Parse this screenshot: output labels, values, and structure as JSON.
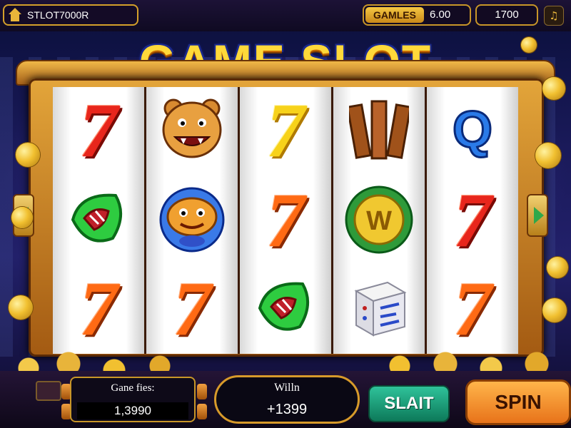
{
  "topbar": {
    "account_name": "STLOT7000R",
    "games_label": "GAMLES",
    "games_value": "6.00",
    "credits_value": "1700",
    "music_icon": "music-note-icon"
  },
  "title": "GAME SLOT",
  "reels": [
    [
      "seven-red",
      "tiger-mascot",
      "seven-orange"
    ],
    [
      "tiger-mascot",
      "crab-mascot",
      "seven-orange"
    ],
    [
      "seven-yellow",
      "seven-orange",
      "green-leaf"
    ],
    [
      "wood-planks",
      "gold-w-medallion",
      "dice-box"
    ],
    [
      "blue-q",
      "seven-red",
      "seven-orange"
    ]
  ],
  "bottombar": {
    "game_files_label": "Gane fies:",
    "game_files_value": "1,3990",
    "win_label": "Willn",
    "win_value": "+1399",
    "slait_label": "SLAIT",
    "spin_label": "SPIN"
  },
  "colors": {
    "accent_gold": "#e8b53a",
    "spin_orange": "#ff9a2a",
    "slait_green": "#1fa87a"
  }
}
